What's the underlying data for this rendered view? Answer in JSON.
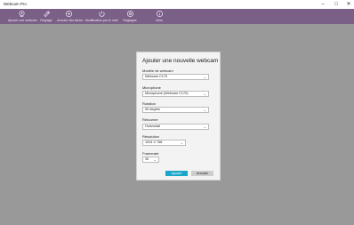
{
  "window": {
    "title": "Webcam Pro",
    "minimize": "–",
    "maximize": "□",
    "close": "✕"
  },
  "toolbar": {
    "items": [
      {
        "label": "Ajouter une webcam",
        "icon": "camera-plus-icon"
      },
      {
        "label": "Réglage",
        "icon": "gear-icon"
      },
      {
        "label": "Annuler des tâche",
        "icon": "undo-icon"
      },
      {
        "label": "Modification par le mail",
        "icon": "mail-edit-icon"
      },
      {
        "label": "Réglages",
        "icon": "settings-icon"
      },
      {
        "label": "Infos",
        "icon": "info-icon"
      }
    ]
  },
  "dialog": {
    "title": "Ajouter une nouvelle webcam",
    "fields": [
      {
        "label": "Modèle de webcam",
        "value": "Webcam C170"
      },
      {
        "label": "Microphone",
        "value": "Microphone (Webcam C170)"
      },
      {
        "label": "Rotation",
        "value": "90 degrés"
      },
      {
        "label": "Retourner",
        "value": "Horizontal"
      },
      {
        "label": "Résolution",
        "value": "1024 X 768"
      },
      {
        "label": "Framerate",
        "value": "30"
      }
    ],
    "buttons": {
      "primary": "Ajouter",
      "secondary": "Annuler"
    }
  },
  "colors": {
    "toolbar": "#7a5f86",
    "accent": "#1aa6c8",
    "overlay": "#999999"
  }
}
